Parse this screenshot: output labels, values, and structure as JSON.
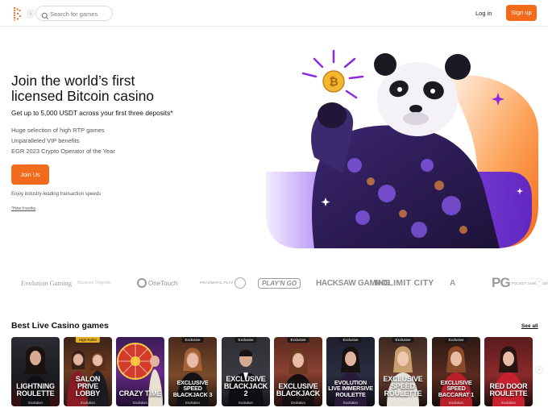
{
  "header": {
    "search_placeholder": "Search for games",
    "login_label": "Log in",
    "signup_label": "Sign up",
    "collapse_icon": "chevron-right-icon"
  },
  "hero": {
    "title": "Join the world’s first licensed Bitcoin casino",
    "subtitle": "Get up to 5,000 USDT across your first three deposits*",
    "features": [
      "Huge selection of high RTP games",
      "Unparalleled VIP benefits",
      "EGR 2023 Crypto Operator of the Year"
    ],
    "join_label": "Join Us",
    "speed_note": "Enjoy industry-leading transaction speeds",
    "how_link": "*How it works",
    "coin_symbol": "₿"
  },
  "providers": [
    {
      "name": "Evolution Gaming"
    },
    {
      "name": "Bitcasino Originals"
    },
    {
      "name": "OneTouch"
    },
    {
      "name": "PRAGMATIC PLAY"
    },
    {
      "name": "PLAY'N GO"
    },
    {
      "name": "HACKSAW GAMING"
    },
    {
      "name": "NOLIMIT CITY"
    },
    {
      "name": "A"
    },
    {
      "name": "PG",
      "extra": "POCKET GAMES SOFT"
    }
  ],
  "live_section": {
    "title": "Best Live Casino games",
    "see_all": "See all"
  },
  "games": [
    {
      "title": "LIGHTNING ROULETTE",
      "tag": "",
      "provider": "Evolution"
    },
    {
      "title": "SALON PRIVE LOBBY",
      "tag": "High Roller",
      "provider": "Evolution"
    },
    {
      "title": "CRAZY TIME",
      "tag": "",
      "provider": "Evolution"
    },
    {
      "title": "EXCLUSIVE SPEED BLACKJACK 3",
      "tag": "Exclusive",
      "provider": "Evolution"
    },
    {
      "title": "EXCLUSIVE BLACKJACK 2",
      "tag": "Exclusive",
      "provider": "Evolution"
    },
    {
      "title": "EXCLUSIVE BLACKJACK",
      "tag": "Exclusive",
      "provider": "Evolution"
    },
    {
      "title": "EVOLUTION LIVE IMMERSIVE ROULETTE",
      "tag": "Exclusive",
      "provider": "Evolution"
    },
    {
      "title": "EXCLUSIVE SPEED ROULETTE",
      "tag": "Exclusive",
      "provider": "Evolution"
    },
    {
      "title": "EXCLUSIVE SPEED BACCARAT 1",
      "tag": "Exclusive",
      "provider": "Evolution"
    },
    {
      "title": "RED DOOR ROULETTE",
      "tag": "",
      "provider": "Evolution"
    }
  ],
  "colors": {
    "accent": "#f26a1b",
    "purple": "#7b3fe4",
    "text": "#111111"
  }
}
